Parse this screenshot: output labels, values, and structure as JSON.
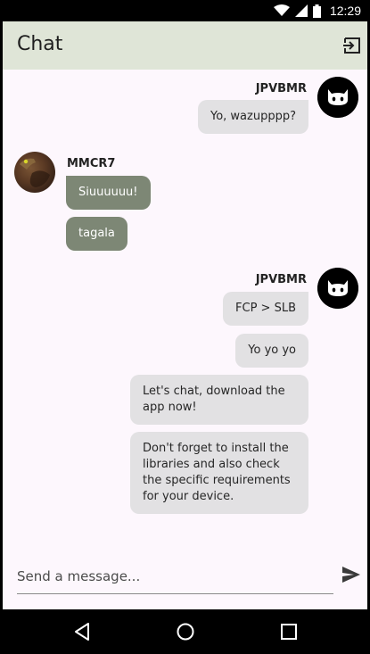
{
  "status_bar": {
    "time": "12:29",
    "icons": [
      "wifi-icon",
      "signal-icon",
      "battery-icon"
    ]
  },
  "app_bar": {
    "title": "Chat",
    "action_icon": "logout-icon"
  },
  "colors": {
    "app_bar_bg": "#dfe5d7",
    "screen_bg": "#fdf7fd",
    "my_bubble": "#e2e1e3",
    "other_bubble": "#7d8775",
    "other_text": "#ffffff"
  },
  "messages": {
    "group1": {
      "user": "JPVBMR",
      "avatar": "github-avatar",
      "items": [
        "Yo, wazupppp?"
      ]
    },
    "group2": {
      "user": "MMCR7",
      "avatar": "photo-avatar",
      "items": [
        "Siuuuuuu!",
        "tagala"
      ]
    },
    "group3": {
      "user": "JPVBMR",
      "avatar": "github-avatar",
      "items": [
        "FCP > SLB",
        "Yo yo yo",
        "Let's chat, download the app now!",
        "Don't forget to install the libraries and also check the specific requirements for your device."
      ]
    }
  },
  "composer": {
    "placeholder": "Send a message...",
    "send_icon": "send-icon"
  },
  "nav_bar": {
    "buttons": [
      "back-icon",
      "home-icon",
      "recents-icon"
    ]
  }
}
